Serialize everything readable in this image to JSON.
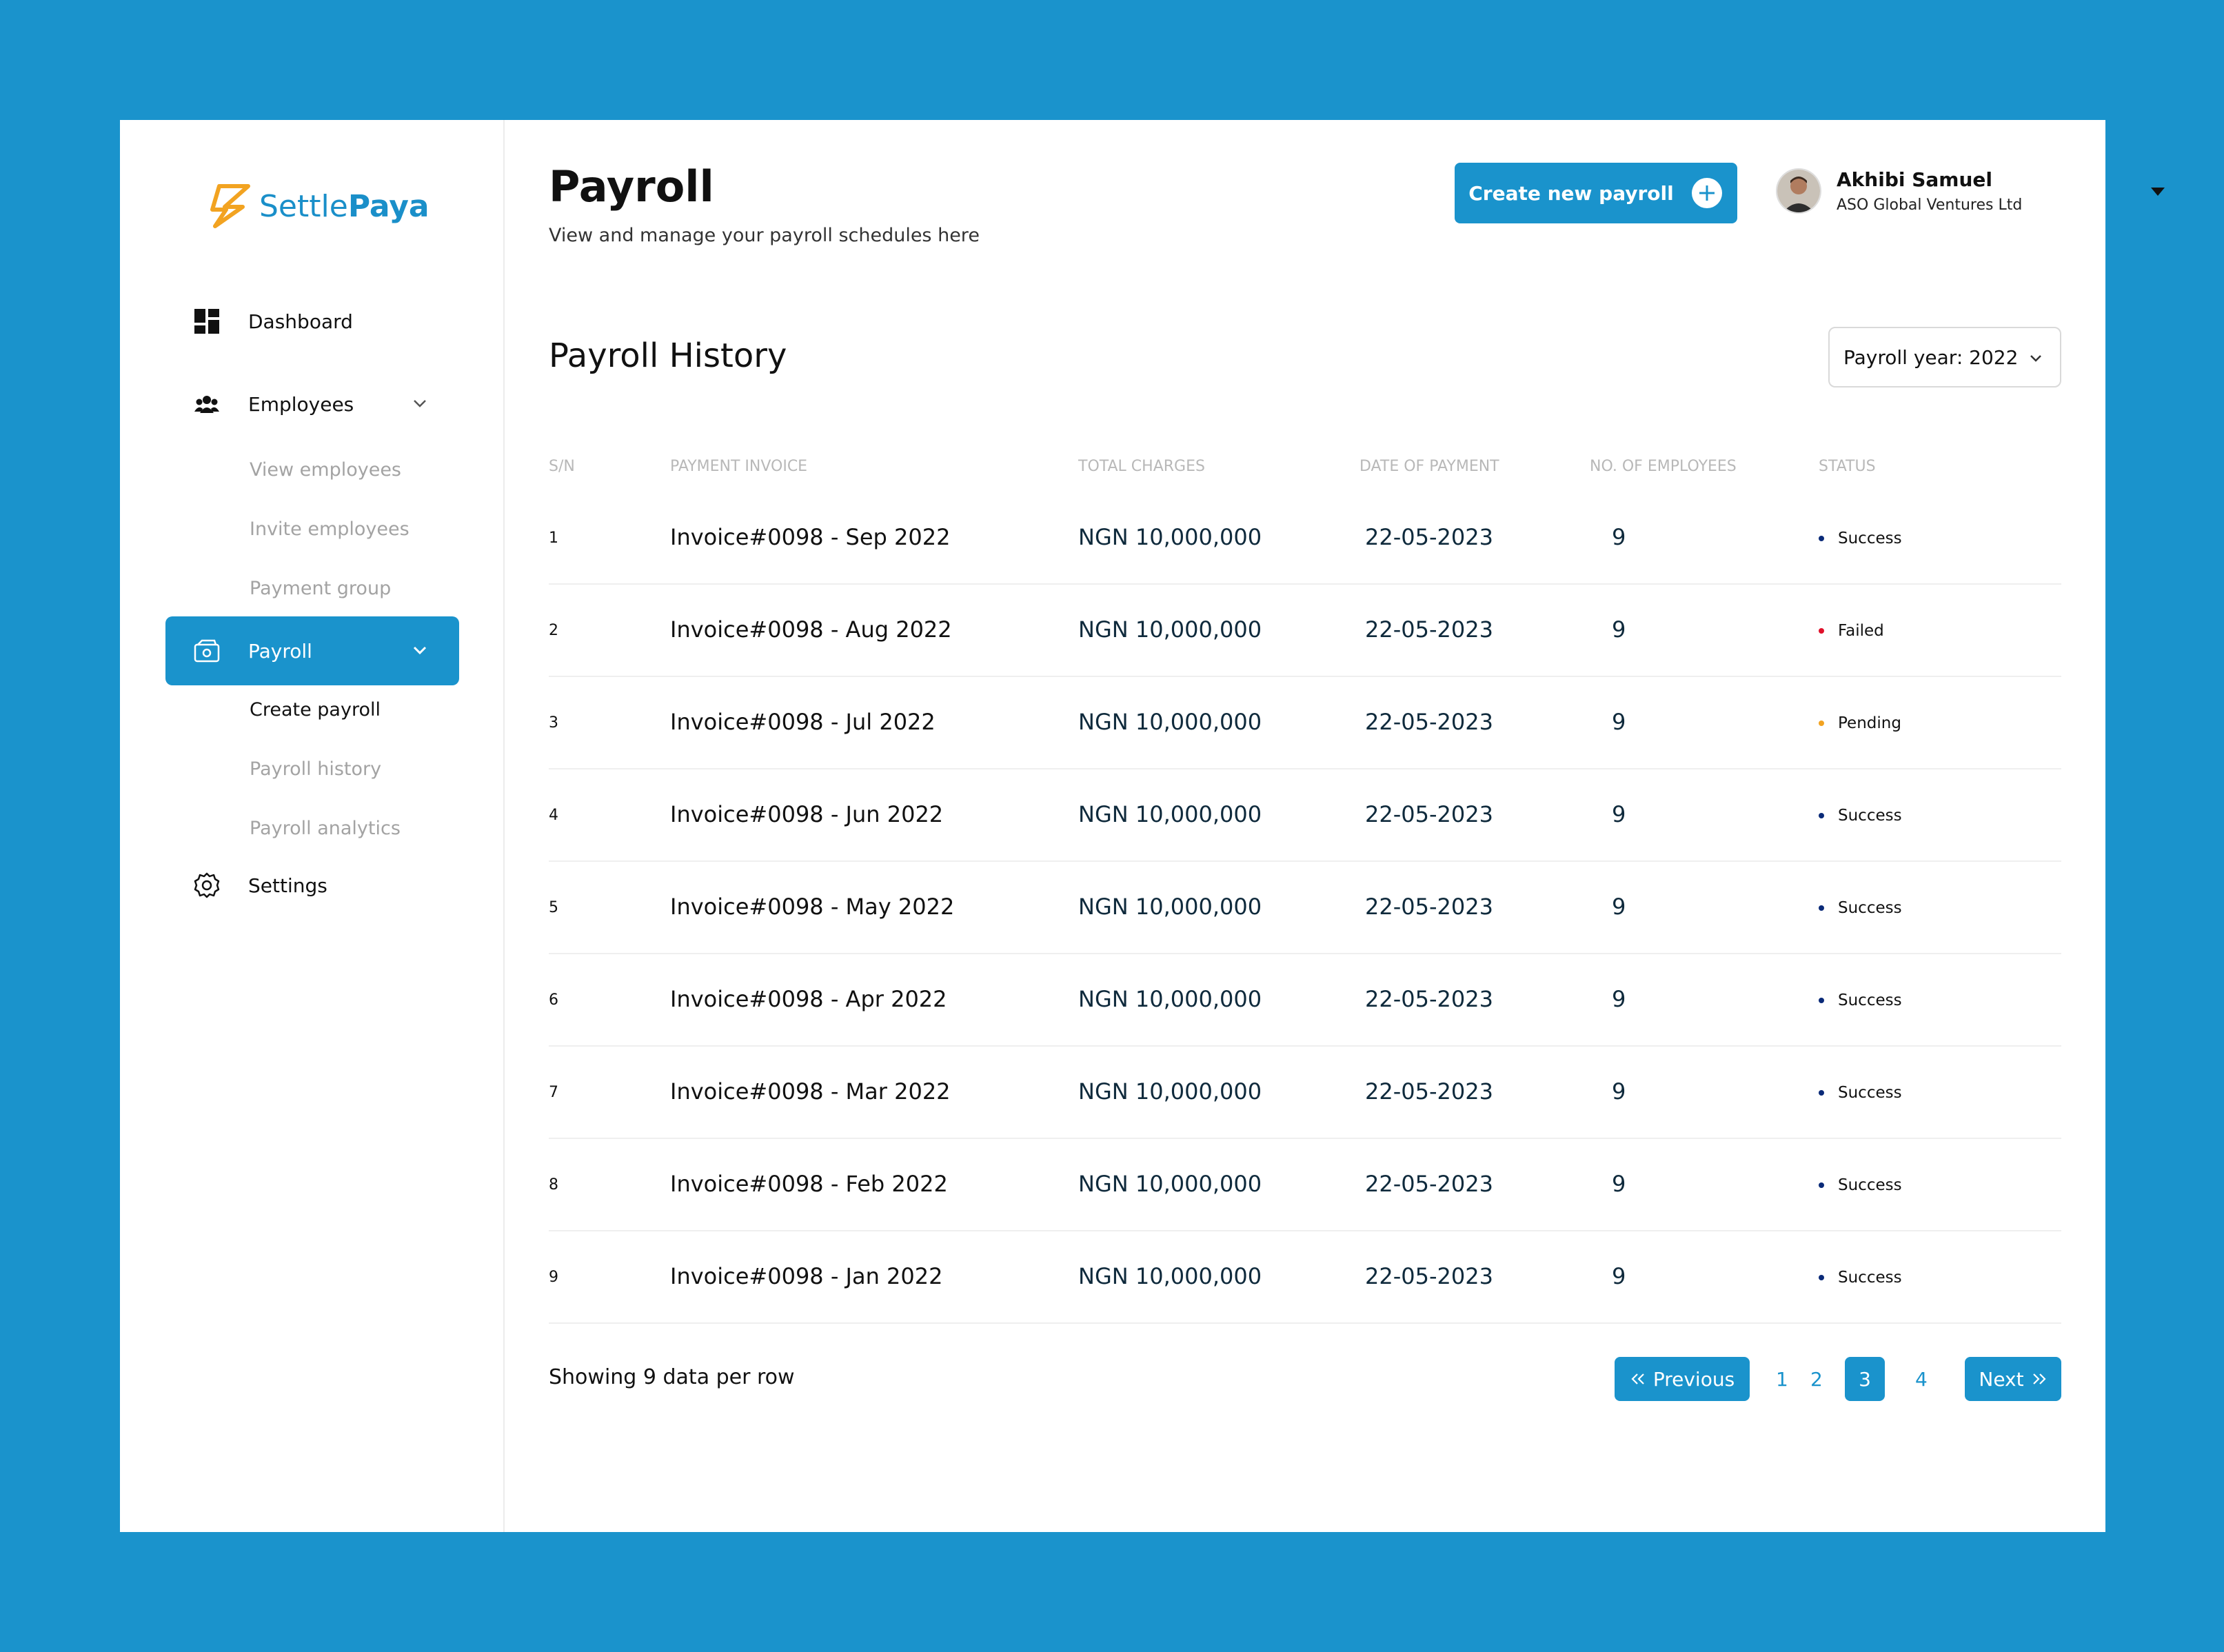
{
  "brand": {
    "name_part1": "Settle",
    "name_part2": "Paya",
    "accent": "#1a93cc",
    "logo_color": "#f2a321"
  },
  "sidebar": {
    "dashboard": "Dashboard",
    "employees": "Employees",
    "employees_sub": [
      "View employees",
      "Invite employees",
      "Payment group"
    ],
    "payroll": "Payroll",
    "payroll_sub": [
      "Create payroll",
      "Payroll history",
      "Payroll analytics"
    ],
    "settings": "Settings"
  },
  "header": {
    "title": "Payroll",
    "subtitle": "View and manage your payroll schedules here",
    "create_button": "Create new payroll",
    "user_name": "Akhibi Samuel",
    "user_company": "ASO Global Ventures Ltd"
  },
  "history": {
    "title": "Payroll History",
    "year_select": "Payroll year: 2022",
    "columns": [
      "S/N",
      "PAYMENT INVOICE",
      "TOTAL CHARGES",
      "DATE OF PAYMENT",
      "NO. OF EMPLOYEES",
      "STATUS"
    ],
    "rows": [
      {
        "sn": "1",
        "invoice": "Invoice#0098 - Sep 2022",
        "total": "NGN 10,000,000",
        "date": "22-05-2023",
        "employees": "9",
        "status": "Success"
      },
      {
        "sn": "2",
        "invoice": "Invoice#0098 - Aug 2022",
        "total": "NGN 10,000,000",
        "date": "22-05-2023",
        "employees": "9",
        "status": "Failed"
      },
      {
        "sn": "3",
        "invoice": "Invoice#0098 - Jul 2022",
        "total": "NGN 10,000,000",
        "date": "22-05-2023",
        "employees": "9",
        "status": "Pending"
      },
      {
        "sn": "4",
        "invoice": "Invoice#0098 - Jun 2022",
        "total": "NGN 10,000,000",
        "date": "22-05-2023",
        "employees": "9",
        "status": "Success"
      },
      {
        "sn": "5",
        "invoice": "Invoice#0098 - May 2022",
        "total": "NGN 10,000,000",
        "date": "22-05-2023",
        "employees": "9",
        "status": "Success"
      },
      {
        "sn": "6",
        "invoice": "Invoice#0098 - Apr 2022",
        "total": "NGN 10,000,000",
        "date": "22-05-2023",
        "employees": "9",
        "status": "Success"
      },
      {
        "sn": "7",
        "invoice": "Invoice#0098 - Mar 2022",
        "total": "NGN 10,000,000",
        "date": "22-05-2023",
        "employees": "9",
        "status": "Success"
      },
      {
        "sn": "8",
        "invoice": "Invoice#0098 - Feb 2022",
        "total": "NGN 10,000,000",
        "date": "22-05-2023",
        "employees": "9",
        "status": "Success"
      },
      {
        "sn": "9",
        "invoice": "Invoice#0098 - Jan 2022",
        "total": "NGN 10,000,000",
        "date": "22-05-2023",
        "employees": "9",
        "status": "Success"
      }
    ],
    "status_colors": {
      "Success": "#0a2a78",
      "Failed": "#e0102a",
      "Pending": "#f2a321"
    }
  },
  "footer": {
    "showing": "Showing 9 data per row",
    "previous": "Previous",
    "next": "Next",
    "pages": [
      "1",
      "2",
      "3",
      "4"
    ],
    "current_page": "3"
  }
}
